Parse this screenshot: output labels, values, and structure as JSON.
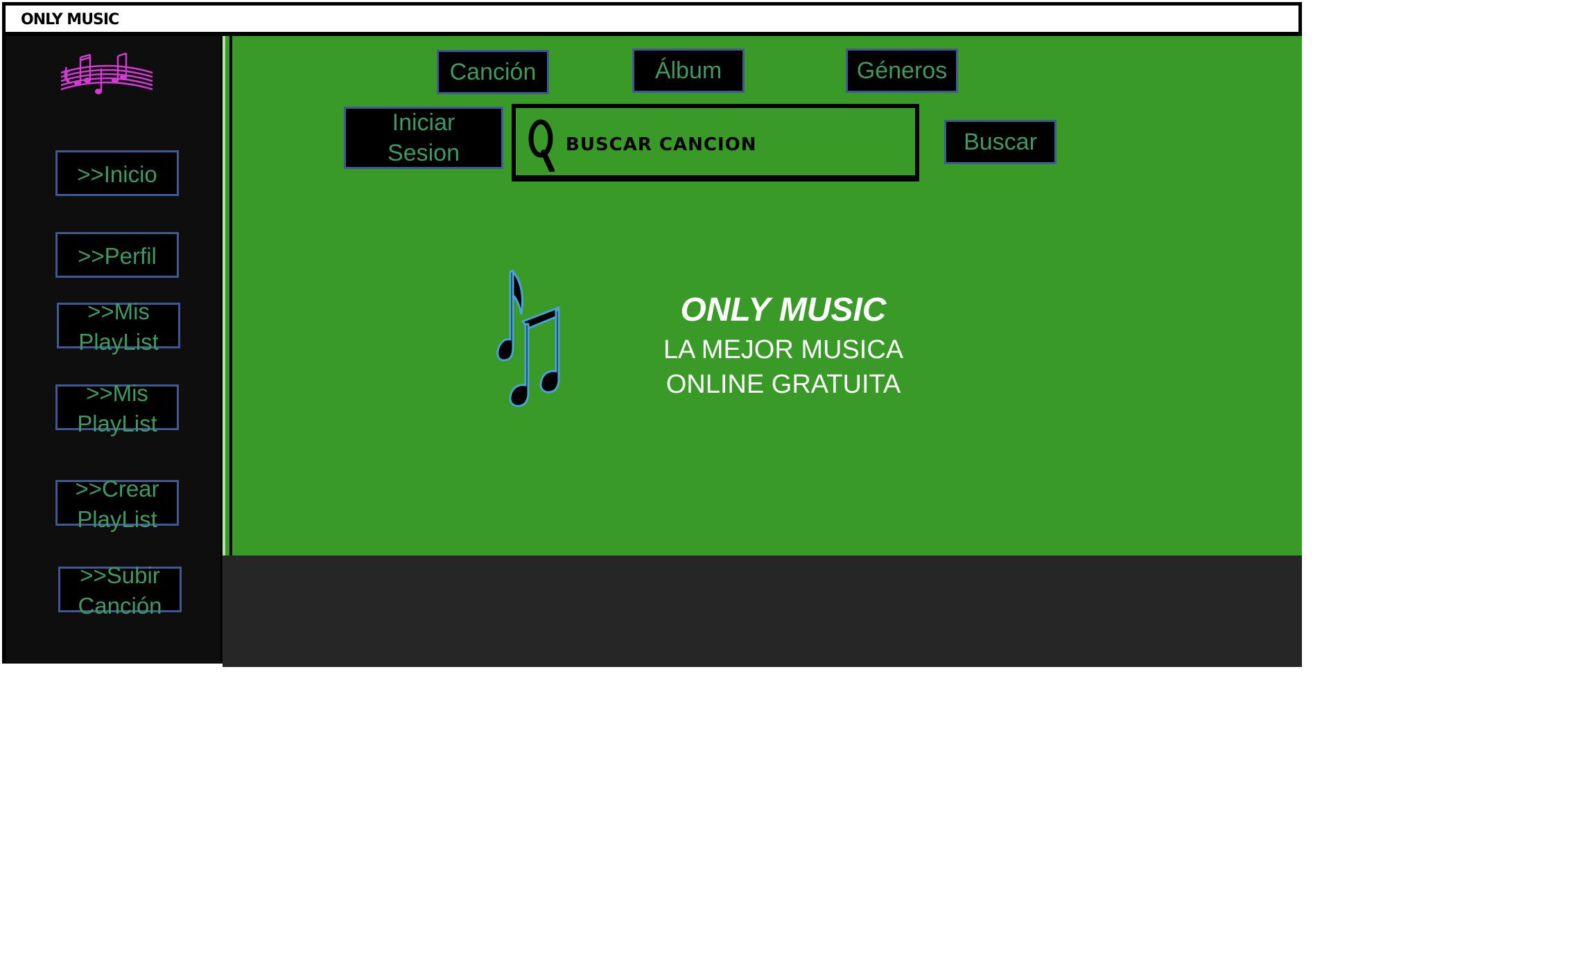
{
  "app": {
    "title": "ONLY MUSIC"
  },
  "sidebar": {
    "logo_icon": "music-staff-icon",
    "items": [
      {
        "label": ">>Inicio"
      },
      {
        "label": ">>Perfil"
      },
      {
        "label": ">>Mis PlayList"
      },
      {
        "label": ">>Mis PlayList"
      },
      {
        "label": ">>Crear PlayList"
      },
      {
        "label": ">>Subir Canción"
      }
    ]
  },
  "header": {
    "tabs": [
      {
        "label": "Canción"
      },
      {
        "label": "Álbum"
      },
      {
        "label": "Géneros"
      }
    ],
    "login_label": "Iniciar Sesion",
    "search": {
      "placeholder": "BUSCAR CANCION",
      "icon": "search-icon"
    },
    "search_button_label": "Buscar"
  },
  "hero": {
    "title": "ONLY MUSIC",
    "subtitle_line1": "LA MEJOR MUSICA",
    "subtitle_line2": "ONLINE GRATUITA",
    "icon": "music-notes-icon"
  },
  "colors": {
    "main_green": "#3a9a27",
    "button_text": "#3f9a61",
    "button_border": "#3e5a96",
    "logo_magenta": "#d63ad6",
    "sidebar_bg": "#0e0e0e",
    "bottom_bar": "#262626"
  }
}
